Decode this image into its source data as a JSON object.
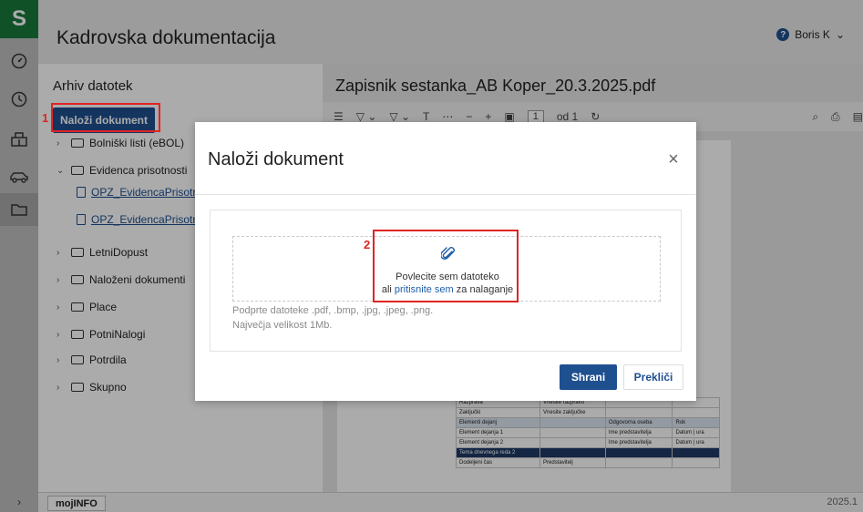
{
  "app": {
    "logo": "S",
    "title": "Kadrovska dokumentacija"
  },
  "user": {
    "name": "Boris K",
    "help": "?",
    "caret": "⌄"
  },
  "rail": {
    "icons": [
      "dashboard-icon",
      "clock-icon",
      "building-icon",
      "car-icon",
      "folder-icon"
    ],
    "expand": "›"
  },
  "left": {
    "heading": "Arhiv datotek",
    "upload_label": "Naloži dokument",
    "tree": [
      {
        "label": "Bolniški listi (eBOL)",
        "chev": "›"
      },
      {
        "label": "Evidenca prisotnosti",
        "chev": "⌄"
      },
      {
        "label": "OPZ_EvidencaPrisotnost",
        "file": true
      },
      {
        "label": "OPZ_EvidencaPrisotnost",
        "file": true
      },
      {
        "label": "LetniDopust",
        "chev": "›"
      },
      {
        "label": "Naloženi dokumenti",
        "chev": "›"
      },
      {
        "label": "Place",
        "chev": "›"
      },
      {
        "label": "PotniNalogi",
        "chev": "›"
      },
      {
        "label": "Potrdila",
        "chev": "›"
      },
      {
        "label": "Skupno",
        "chev": "›"
      }
    ]
  },
  "doc": {
    "name": "Zapisnik sestanka_AB Koper_20.3.2025.pdf",
    "page_current": "1",
    "page_total": "od 1",
    "table": [
      {
        "cells": [
          "Razprava",
          "Vnesite razpravo",
          "",
          ""
        ],
        "cls": ""
      },
      {
        "cells": [
          "Zaključki",
          "Vnesite zaključke",
          "",
          ""
        ],
        "cls": ""
      },
      {
        "cells": [
          "Elementi dejanj",
          "",
          "Odgovorna oseba",
          "Rok"
        ],
        "cls": "shade"
      },
      {
        "cells": [
          "Element dejanja 1",
          "",
          "Ime predstavitelja",
          "Datum | ura"
        ],
        "cls": ""
      },
      {
        "cells": [
          "Element dejanja 2",
          "",
          "Ime predstavitelja",
          "Datum | ura"
        ],
        "cls": ""
      },
      {
        "cells": [
          "Tema dnevnega reda 2",
          "",
          "",
          ""
        ],
        "cls": "head"
      },
      {
        "cells": [
          "Dodeljeni čas",
          "Predstavitelj",
          "",
          ""
        ],
        "cls": ""
      }
    ]
  },
  "status": {
    "tab": "mojINFO",
    "version": "2025.1"
  },
  "modal": {
    "title": "Naloži dokument",
    "close": "×",
    "drop_line1": "Povlecite sem datoteko",
    "drop_prefix": "ali",
    "drop_link": "pritisnite sem",
    "drop_suffix": "za nalaganje",
    "hint_types": "Podprte datoteke .pdf, .bmp, .jpg, .jpeg, .png.",
    "hint_size": "Največja velikost 1Mb.",
    "save": "Shrani",
    "cancel": "Prekliči"
  },
  "annotations": {
    "step1": "1",
    "step2": "2"
  },
  "colors": {
    "accent": "#1e4f8f",
    "brand": "#1a7a3c",
    "highlight": "#e02424"
  }
}
